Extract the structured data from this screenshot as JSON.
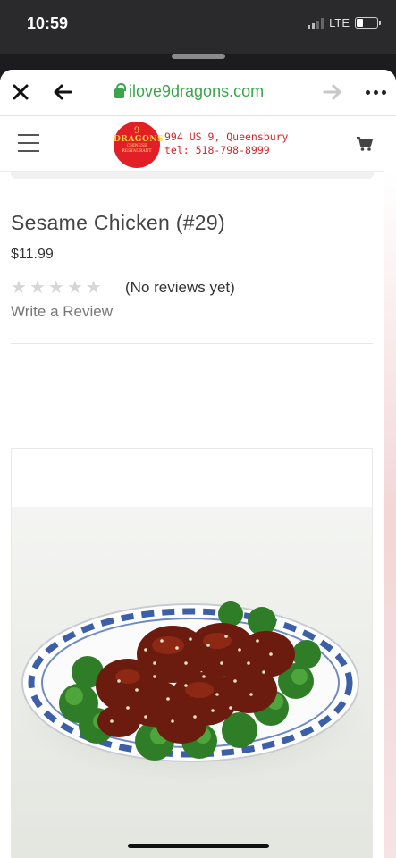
{
  "status_bar": {
    "time": "10:59",
    "network": "LTE"
  },
  "browser": {
    "url": "ilove9dragons.com",
    "buttons": {
      "close": "close-icon",
      "back": "arrow-left-icon",
      "forward": "arrow-right-icon",
      "more": "more-icon"
    }
  },
  "site": {
    "logo": {
      "number": "9",
      "name": "DRAGONS",
      "sub": "CHINESE RESTAURANT"
    },
    "address_line": "994 US 9, Queensbury",
    "phone_line": "tel: 518-798-8999"
  },
  "product": {
    "title": "Sesame Chicken (#29)",
    "price": "$11.99",
    "rating": {
      "filled": 0,
      "total": 5
    },
    "reviews_note": "(No reviews yet)",
    "write_review": "Write a Review"
  },
  "colors": {
    "url_green": "#3aa54a",
    "logo_red": "#e21f26",
    "address_red": "#d8232a"
  }
}
